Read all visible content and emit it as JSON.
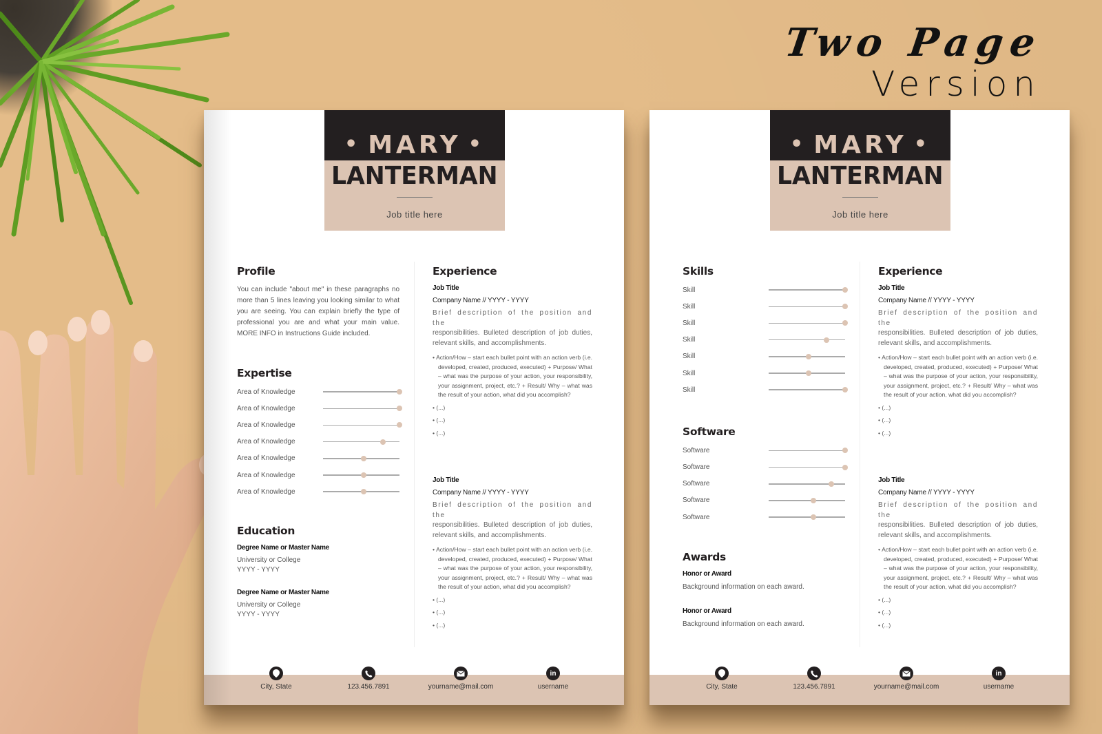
{
  "headline": {
    "script": "Two Page",
    "version": "Version"
  },
  "colors": {
    "background": "#e4bc89",
    "dark": "#231f20",
    "accent": "#dcc4b3"
  },
  "pages": [
    {
      "name": {
        "first": "MARY",
        "last": "LANTERMAN",
        "job_title": "Job title here"
      },
      "profile": {
        "heading": "Profile",
        "text": "You can include \"about me\" in these paragraphs no more than 5 lines leaving you looking similar to what you are seeing. You can explain briefly the type of professional you are and what your main value. MORE INFO in Instructions Guide included."
      },
      "expertise": {
        "heading": "Expertise",
        "items": [
          {
            "label": "Area of Knowledge",
            "level": 1.0
          },
          {
            "label": "Area of Knowledge",
            "level": 1.0
          },
          {
            "label": "Area of Knowledge",
            "level": 1.0
          },
          {
            "label": "Area of Knowledge",
            "level": 0.78
          },
          {
            "label": "Area of Knowledge",
            "level": 0.53
          },
          {
            "label": "Area of Knowledge",
            "level": 0.53
          },
          {
            "label": "Area of Knowledge",
            "level": 0.53
          }
        ]
      },
      "education": {
        "heading": "Education",
        "items": [
          {
            "degree": "Degree Name or Master Name",
            "school": "University or College",
            "years": "YYYY - YYYY"
          },
          {
            "degree": "Degree Name or Master Name",
            "school": "University or College",
            "years": "YYYY - YYYY"
          }
        ]
      },
      "experience": {
        "heading": "Experience",
        "jobs": [
          {
            "title": "Job Title",
            "company": "Company Name // YYYY - YYYY",
            "desc_first": "Brief description of the position and the",
            "desc_rest": "responsibilities. Bulleted description of job duties, relevant skills, and accomplishments.",
            "bullet": "• Action/How – start each bullet point with an action verb (i.e. developed, created, produced, executed) + Purpose/ What – what was the purpose of your action, your responsibility, your assignment, project, etc.? + Result/ Why – what was the result of your action, what did you accomplish?",
            "more": [
              "• (...)",
              "• (...)",
              "• (...)"
            ]
          },
          {
            "title": "Job Title",
            "company": "Company Name // YYYY - YYYY",
            "desc_first": "Brief description of the position and the",
            "desc_rest": "responsibilities. Bulleted description of job duties, relevant skills, and accomplishments.",
            "bullet": "• Action/How – start each bullet point with an action verb (i.e. developed, created, produced, executed) + Purpose/ What – what was the purpose of your action, your responsibility, your assignment, project, etc.? + Result/ Why – what was the result of your action, what did you accomplish?",
            "more": [
              "• (...)",
              "• (...)",
              "• (...)"
            ]
          }
        ]
      },
      "contacts": [
        {
          "icon": "location-pin-icon",
          "text": "City, State"
        },
        {
          "icon": "phone-icon",
          "text": "123.456.7891"
        },
        {
          "icon": "mail-icon",
          "text": "yourname@mail.com"
        },
        {
          "icon": "linkedin-icon",
          "text": "username"
        }
      ]
    },
    {
      "name": {
        "first": "MARY",
        "last": "LANTERMAN",
        "job_title": "Job title here"
      },
      "skills": {
        "heading": "Skills",
        "items": [
          {
            "label": "Skill",
            "level": 1.0
          },
          {
            "label": "Skill",
            "level": 1.0
          },
          {
            "label": "Skill",
            "level": 1.0
          },
          {
            "label": "Skill",
            "level": 0.76
          },
          {
            "label": "Skill",
            "level": 0.52
          },
          {
            "label": "Skill",
            "level": 0.52
          },
          {
            "label": "Skill",
            "level": 1.0
          }
        ]
      },
      "software": {
        "heading": "Software",
        "items": [
          {
            "label": "Software",
            "level": 1.0
          },
          {
            "label": "Software",
            "level": 1.0
          },
          {
            "label": "Software",
            "level": 0.82
          },
          {
            "label": "Software",
            "level": 0.59
          },
          {
            "label": "Software",
            "level": 0.59
          }
        ]
      },
      "awards": {
        "heading": "Awards",
        "items": [
          {
            "title": "Honor or Award",
            "desc": "Background information on each award."
          },
          {
            "title": "Honor or Award",
            "desc": "Background information on each award."
          }
        ]
      },
      "experience": {
        "heading": "Experience",
        "jobs": [
          {
            "title": "Job Title",
            "company": "Company Name // YYYY - YYYY",
            "desc_first": "Brief description of the position and the",
            "desc_rest": "responsibilities. Bulleted description of job duties, relevant skills, and accomplishments.",
            "bullet": "• Action/How – start each bullet point with an action verb (i.e. developed, created, produced, executed) + Purpose/ What – what was the purpose of your action, your responsibility, your assignment, project, etc.? + Result/ Why – what was the result of your action, what did you accomplish?",
            "more": [
              "• (...)",
              "• (...)",
              "• (...)"
            ]
          },
          {
            "title": "Job Title",
            "company": "Company Name // YYYY - YYYY",
            "desc_first": "Brief description of the position and the",
            "desc_rest": "responsibilities. Bulleted description of job duties, relevant skills, and accomplishments.",
            "bullet": "• Action/How – start each bullet point with an action verb (i.e. developed, created, produced, executed) + Purpose/ What – what was the purpose of your action, your responsibility, your assignment, project, etc.? + Result/ Why – what was the result of your action, what did you accomplish?",
            "more": [
              "• (...)",
              "• (...)",
              "• (...)"
            ]
          }
        ]
      },
      "contacts": [
        {
          "icon": "location-pin-icon",
          "text": "City, State"
        },
        {
          "icon": "phone-icon",
          "text": "123.456.7891"
        },
        {
          "icon": "mail-icon",
          "text": "yourname@mail.com"
        },
        {
          "icon": "linkedin-icon",
          "text": "username"
        }
      ]
    }
  ]
}
